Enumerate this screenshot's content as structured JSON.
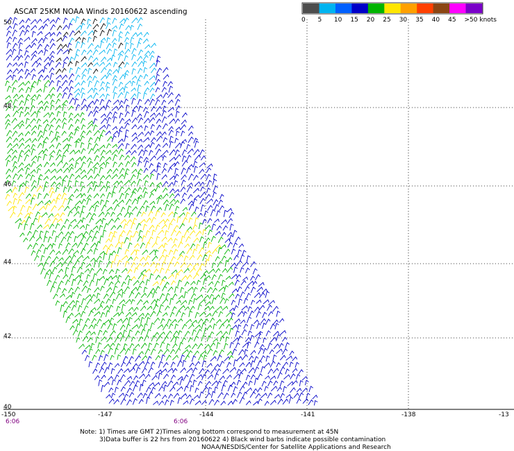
{
  "title": "ASCAT 25KM NOAA Winds 20160622 ascending",
  "legend": {
    "labels": [
      "0",
      "5",
      "10",
      "15",
      "20",
      "25",
      "30",
      "35",
      "40",
      "45",
      ">50 knots"
    ],
    "colors": [
      "#4d4d4d",
      "#00b4f0",
      "#0060ff",
      "#0000c8",
      "#00b400",
      "#ffe600",
      "#ffa000",
      "#ff4000",
      "#8b4513",
      "#ff00ff",
      "#7a00c8"
    ]
  },
  "longitude_labels": [
    "-150",
    "-147",
    "-144",
    "-141",
    "-138",
    "-13"
  ],
  "latitude_labels": [
    "50",
    "48",
    "46",
    "44",
    "42",
    "40"
  ],
  "time_labels": [
    "6:06",
    "6:06"
  ],
  "notes": [
    "Note: 1) Times are GMT 2)Times along bottom correspond to measurement at 45N",
    "3)Data buffer is 22 hrs from 20160622 4) Black wind barbs indicate possible contamination",
    "NOAA/NESDIS/Center for Satellite Applications and Research"
  ],
  "wind_colors": {
    "contaminated": "#000000",
    "speed_0_5": "#4d4d4d",
    "speed_5_10": "#00b4f0",
    "speed_10_15": "#0000c8",
    "speed_15_20": "#00b400",
    "speed_20_25": "#ffe600"
  }
}
